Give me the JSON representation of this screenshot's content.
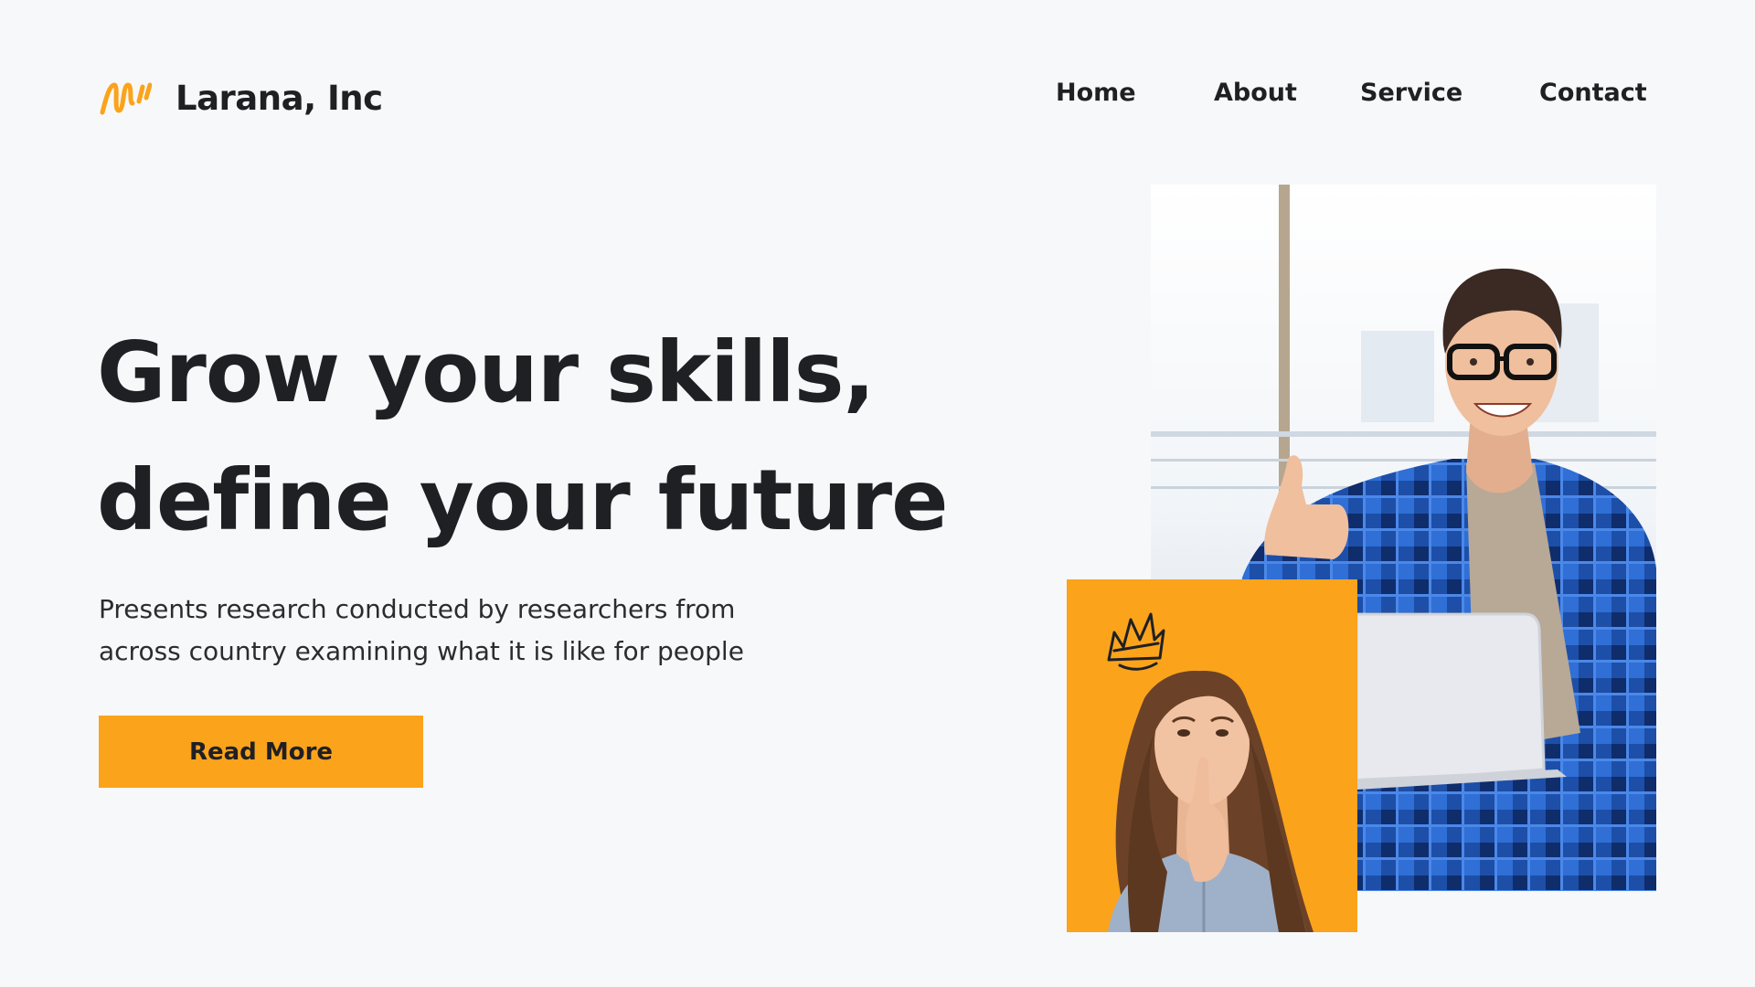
{
  "brand": {
    "name": "Larana, Inc",
    "logo_icon": "wave-logo-icon",
    "accent_color": "#fba31b"
  },
  "nav": {
    "items": [
      {
        "label": "Home"
      },
      {
        "label": "About"
      },
      {
        "label": "Service"
      },
      {
        "label": "Contact"
      }
    ]
  },
  "hero": {
    "title_line1": "Grow your skills,",
    "title_line2": "define your future",
    "description_line1": "Presents research conducted by researchers from",
    "description_line2": "across country examining what it is like for people",
    "cta_label": "Read More"
  },
  "images": {
    "main_photo": "smiling-man-with-laptop-thumbs-up",
    "secondary_photo": "thinking-woman-on-orange-background",
    "crown_icon": "crown-doodle-icon"
  },
  "colors": {
    "background": "#f7f8fa",
    "text": "#1f2024",
    "accent": "#fba31b"
  }
}
